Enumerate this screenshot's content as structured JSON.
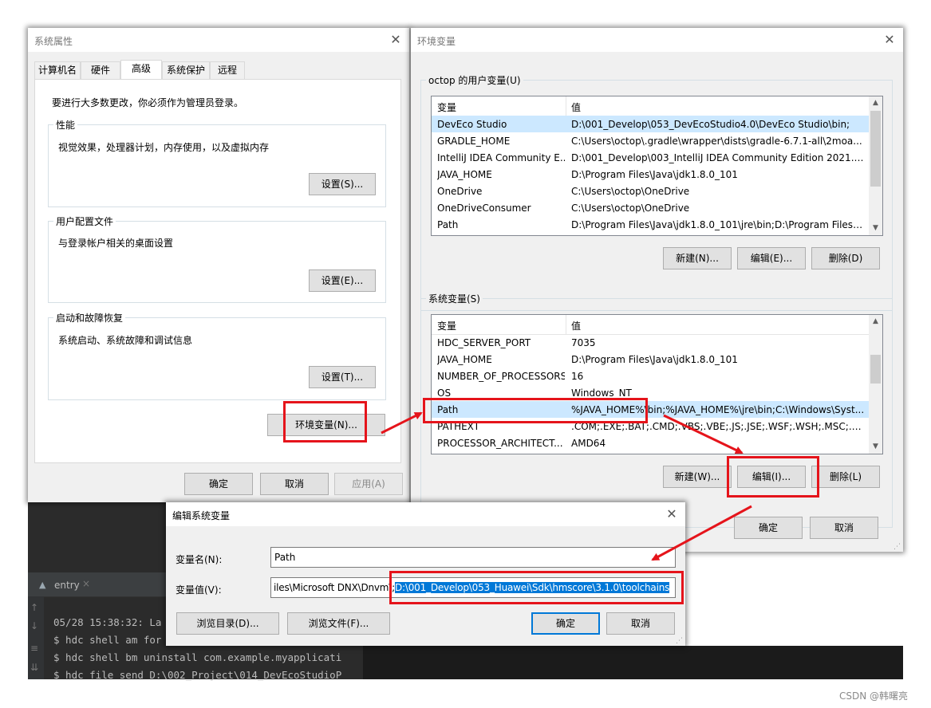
{
  "sysprops": {
    "title": "系统属性",
    "tabs": [
      {
        "label": "计算机名"
      },
      {
        "label": "硬件"
      },
      {
        "label": "高级"
      },
      {
        "label": "系统保护"
      },
      {
        "label": "远程"
      }
    ],
    "admin_note": "要进行大多数更改，你必须作为管理员登录。",
    "perf": {
      "label": "性能",
      "desc": "视觉效果，处理器计划，内存使用，以及虚拟内存",
      "button": "设置(S)..."
    },
    "profile": {
      "label": "用户配置文件",
      "desc": "与登录帐户相关的桌面设置",
      "button": "设置(E)..."
    },
    "startup": {
      "label": "启动和故障恢复",
      "desc": "系统启动、系统故障和调试信息",
      "button": "设置(T)..."
    },
    "env_button": "环境变量(N)...",
    "ok": "确定",
    "cancel": "取消",
    "apply": "应用(A)"
  },
  "envvars": {
    "title": "环境变量",
    "user_group": "octop 的用户变量(U)",
    "col_var": "变量",
    "col_val": "值",
    "user_rows": [
      {
        "name": "DevEco Studio",
        "value": "D:\\001_Develop\\053_DevEcoStudio4.0\\DevEco Studio\\bin;"
      },
      {
        "name": "GRADLE_HOME",
        "value": "C:\\Users\\octop\\.gradle\\wrapper\\dists\\gradle-6.7.1-all\\2moa..."
      },
      {
        "name": "IntelliJ IDEA Community E...",
        "value": "D:\\001_Develop\\003_IntelliJ IDEA Community Edition 2021.1.1..."
      },
      {
        "name": "JAVA_HOME",
        "value": "D:\\Program Files\\Java\\jdk1.8.0_101"
      },
      {
        "name": "OneDrive",
        "value": "C:\\Users\\octop\\OneDrive"
      },
      {
        "name": "OneDriveConsumer",
        "value": "C:\\Users\\octop\\OneDrive"
      },
      {
        "name": "Path",
        "value": "D:\\Program Files\\Java\\jdk1.8.0_101\\jre\\bin;D:\\Program Files\\J..."
      }
    ],
    "user_new": "新建(N)...",
    "user_edit": "编辑(E)...",
    "user_delete": "删除(D)",
    "sys_group": "系统变量(S)",
    "sys_rows": [
      {
        "name": "HDC_SERVER_PORT",
        "value": "7035"
      },
      {
        "name": "JAVA_HOME",
        "value": "D:\\Program Files\\Java\\jdk1.8.0_101"
      },
      {
        "name": "NUMBER_OF_PROCESSORS",
        "value": "16"
      },
      {
        "name": "OS",
        "value": "Windows_NT"
      },
      {
        "name": "Path",
        "value": "%JAVA_HOME%\\bin;%JAVA_HOME%\\jre\\bin;C:\\Windows\\Syst..."
      },
      {
        "name": "PATHEXT",
        "value": ".COM;.EXE;.BAT;.CMD;.VBS;.VBE;.JS;.JSE;.WSF;.WSH;.MSC;.PY;.P..."
      },
      {
        "name": "PROCESSOR_ARCHITECT...",
        "value": "AMD64"
      }
    ],
    "sys_new": "新建(W)...",
    "sys_edit": "编辑(I)...",
    "sys_delete": "删除(L)",
    "ok": "确定",
    "cancel": "取消"
  },
  "edit": {
    "title": "编辑系统变量",
    "name_label": "变量名(N):",
    "name_value": "Path",
    "value_label": "变量值(V):",
    "value_prefix": "iles\\Microsoft DNX\\Dnvm\\;",
    "value_selected": "D:\\001_Develop\\053_Huawei\\Sdk\\hmscore\\3.1.0\\toolchains",
    "browse_dir": "浏览目录(D)...",
    "browse_file": "浏览文件(F)...",
    "ok": "确定",
    "cancel": "取消"
  },
  "ide": {
    "tab": "entry",
    "lines": [
      "05/28 15:38:32: La",
      "$ hdc shell am for",
      "$ hdc shell bm uninstall com.example.myapplicati",
      "$ hdc file send D:\\002_Project\\014_DevEcoStudioP"
    ]
  },
  "watermark": "CSDN @韩曙亮",
  "colors": {
    "highlight": "#e5141b",
    "selection": "#0078d7",
    "list_selected": "#cce8ff"
  }
}
